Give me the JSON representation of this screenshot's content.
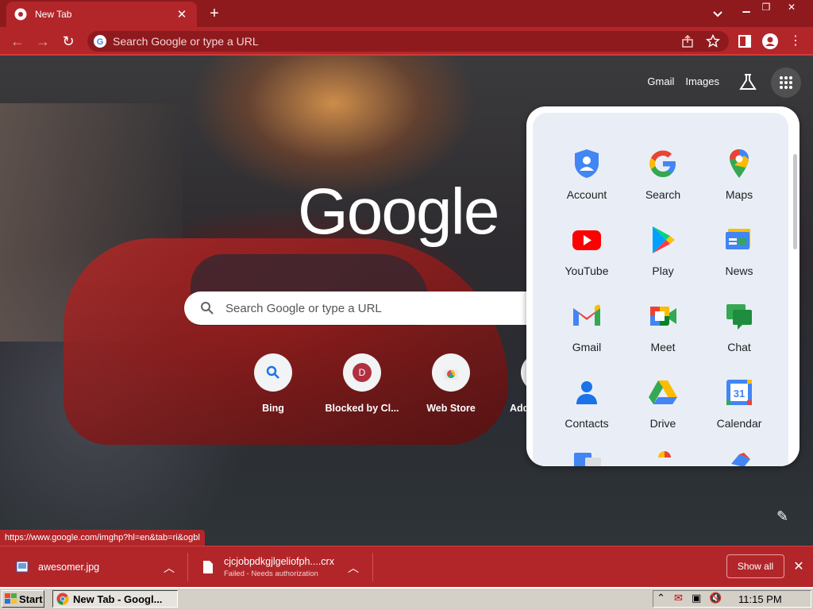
{
  "browser": {
    "tab": {
      "title": "New Tab"
    },
    "omnibox": {
      "placeholder": "Search Google or type a URL"
    }
  },
  "ntp": {
    "top_links": {
      "gmail": "Gmail",
      "images": "Images"
    },
    "logo": "Google",
    "search_placeholder": "Search Google or type a URL",
    "shortcuts": [
      {
        "label": "Bing",
        "icon": "search-icon"
      },
      {
        "label": "Blocked by Cl...",
        "icon": "letter-d-icon",
        "letter": "D"
      },
      {
        "label": "Web Store",
        "icon": "webstore-icon"
      },
      {
        "label": "Add",
        "icon": "add-icon"
      }
    ]
  },
  "apps_panel": {
    "apps": [
      {
        "label": "Account",
        "icon": "account-icon"
      },
      {
        "label": "Search",
        "icon": "google-g-icon"
      },
      {
        "label": "Maps",
        "icon": "maps-icon"
      },
      {
        "label": "YouTube",
        "icon": "youtube-icon"
      },
      {
        "label": "Play",
        "icon": "play-icon"
      },
      {
        "label": "News",
        "icon": "news-icon"
      },
      {
        "label": "Gmail",
        "icon": "gmail-icon"
      },
      {
        "label": "Meet",
        "icon": "meet-icon"
      },
      {
        "label": "Chat",
        "icon": "chat-icon"
      },
      {
        "label": "Contacts",
        "icon": "contacts-icon"
      },
      {
        "label": "Drive",
        "icon": "drive-icon"
      },
      {
        "label": "Calendar",
        "icon": "calendar-icon",
        "day": "31"
      }
    ]
  },
  "status_url": "https://www.google.com/imghp?hl=en&tab=ri&ogbl",
  "downloads": [
    {
      "name": "awesomer.jpg",
      "status": ""
    },
    {
      "name": "cjcjobpdkgjlgeliofph....crx",
      "status": "Failed - Needs authorization"
    }
  ],
  "download_bar": {
    "show_all": "Show all"
  },
  "taskbar": {
    "start": "Start",
    "task": "New Tab - Googl...",
    "clock": "11:15 PM"
  },
  "colors": {
    "chrome_red": "#b2262a",
    "chrome_dark": "#8e1a1e"
  }
}
